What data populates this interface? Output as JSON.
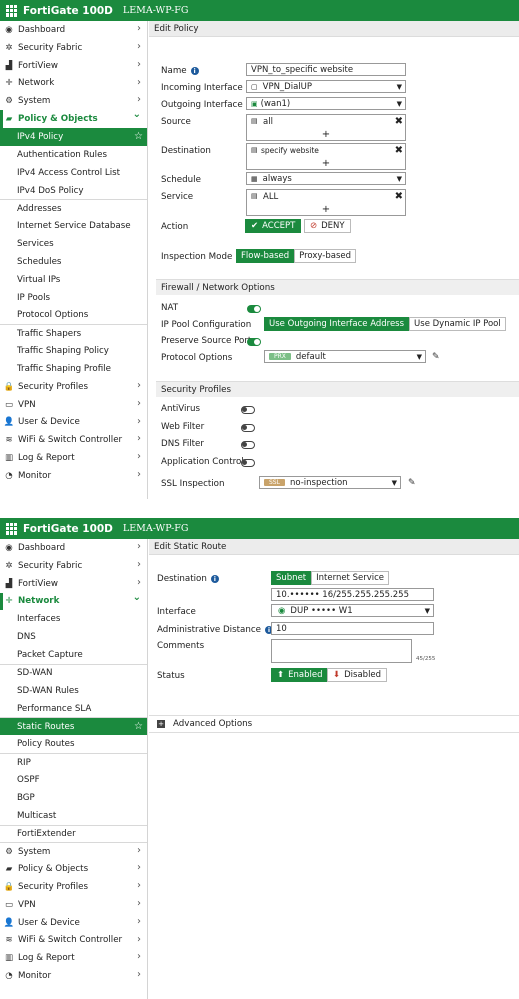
{
  "panel1": {
    "brand": "FortiGate 100D",
    "hostname": "LEMA-WP-FG",
    "nav": [
      {
        "label": "Dashboard",
        "icon": "dashboard-icon",
        "chevron": true
      },
      {
        "label": "Security Fabric",
        "icon": "fabric-icon",
        "chevron": true
      },
      {
        "label": "FortiView",
        "icon": "chart-icon",
        "chevron": true
      },
      {
        "label": "Network",
        "icon": "network-icon",
        "chevron": true
      },
      {
        "label": "System",
        "icon": "gear-icon",
        "chevron": true
      },
      {
        "label": "Policy & Objects",
        "icon": "policy-icon",
        "chevron": true
      },
      {
        "label": "IPv4 Policy"
      },
      {
        "label": "Authentication Rules"
      },
      {
        "label": "IPv4 Access Control List"
      },
      {
        "label": "IPv4 DoS Policy"
      },
      {
        "label": "Addresses"
      },
      {
        "label": "Internet Service Database"
      },
      {
        "label": "Services"
      },
      {
        "label": "Schedules"
      },
      {
        "label": "Virtual IPs"
      },
      {
        "label": "IP Pools"
      },
      {
        "label": "Protocol Options"
      },
      {
        "label": "Traffic Shapers"
      },
      {
        "label": "Traffic Shaping Policy"
      },
      {
        "label": "Traffic Shaping Profile"
      },
      {
        "label": "Security Profiles",
        "icon": "lock-icon",
        "chevron": true
      },
      {
        "label": "VPN",
        "icon": "vpn-icon",
        "chevron": true
      },
      {
        "label": "User & Device",
        "icon": "user-icon",
        "chevron": true
      },
      {
        "label": "WiFi & Switch Controller",
        "icon": "wifi-icon",
        "chevron": true
      },
      {
        "label": "Log & Report",
        "icon": "log-icon",
        "chevron": true
      },
      {
        "label": "Monitor",
        "icon": "monitor-icon",
        "chevron": true
      }
    ],
    "header": "Edit Policy",
    "form": {
      "name_label": "Name",
      "name_value": "VPN_to_specific website",
      "incoming_label": "Incoming Interface",
      "incoming_value": "VPN_DialUP",
      "outgoing_label": "Outgoing Interface",
      "outgoing_value": "(wan1)",
      "source_label": "Source",
      "source_value": "all",
      "destination_label": "Destination",
      "destination_value": "specify website",
      "schedule_label": "Schedule",
      "schedule_value": "always",
      "service_label": "Service",
      "service_value": "ALL",
      "action_label": "Action",
      "accept": "ACCEPT",
      "deny": "DENY",
      "inspection_label": "Inspection Mode",
      "flow_based": "Flow-based",
      "proxy_based": "Proxy-based"
    },
    "firewall_section": "Firewall / Network Options",
    "nat_label": "NAT",
    "ippool_label": "IP Pool Configuration",
    "use_outgoing": "Use Outgoing Interface Address",
    "use_dynamic": "Use Dynamic IP Pool",
    "preserve_label": "Preserve Source Port",
    "protocol_label": "Protocol Options",
    "protocol_badge": "PRX",
    "protocol_value": "default",
    "security_section": "Security Profiles",
    "antivirus": "AntiVirus",
    "webfilter": "Web Filter",
    "dnsfilter": "DNS Filter",
    "appcontrol": "Application Control",
    "ssl_label": "SSL Inspection",
    "ssl_badge": "SSL",
    "ssl_value": "no-inspection",
    "plus": "+"
  },
  "panel2": {
    "brand": "FortiGate 100D",
    "hostname": "LEMA-WP-FG",
    "nav": [
      {
        "label": "Dashboard",
        "icon": "dashboard-icon",
        "chevron": true
      },
      {
        "label": "Security Fabric",
        "icon": "fabric-icon",
        "chevron": true
      },
      {
        "label": "FortiView",
        "icon": "chart-icon",
        "chevron": true
      },
      {
        "label": "Network",
        "icon": "network-icon",
        "chevron": true
      },
      {
        "label": "Interfaces"
      },
      {
        "label": "DNS"
      },
      {
        "label": "Packet Capture"
      },
      {
        "label": "SD-WAN"
      },
      {
        "label": "SD-WAN Rules"
      },
      {
        "label": "Performance SLA"
      },
      {
        "label": "Static Routes"
      },
      {
        "label": "Policy Routes"
      },
      {
        "label": "RIP"
      },
      {
        "label": "OSPF"
      },
      {
        "label": "BGP"
      },
      {
        "label": "Multicast"
      },
      {
        "label": "FortiExtender"
      },
      {
        "label": "System",
        "icon": "gear-icon",
        "chevron": true
      },
      {
        "label": "Policy & Objects",
        "icon": "policy-icon",
        "chevron": true
      },
      {
        "label": "Security Profiles",
        "icon": "lock-icon",
        "chevron": true
      },
      {
        "label": "VPN",
        "icon": "vpn-icon",
        "chevron": true
      },
      {
        "label": "User & Device",
        "icon": "user-icon",
        "chevron": true
      },
      {
        "label": "WiFi & Switch Controller",
        "icon": "wifi-icon",
        "chevron": true
      },
      {
        "label": "Log & Report",
        "icon": "log-icon",
        "chevron": true
      },
      {
        "label": "Monitor",
        "icon": "monitor-icon",
        "chevron": true
      }
    ],
    "header": "Edit Static Route",
    "destination_label": "Destination",
    "subnet": "Subnet",
    "internet_service": "Internet Service",
    "destination_value": "10.•••••• 16/255.255.255.255",
    "interface_label": "Interface",
    "interface_value": "DUP ••••• W1",
    "admin_distance_label": "Administrative Distance",
    "admin_distance_value": "10",
    "comments_label": "Comments",
    "comments_count": "45/255",
    "status_label": "Status",
    "enabled": "Enabled",
    "disabled": "Disabled",
    "advanced": "Advanced Options"
  },
  "colors": {
    "accent": "#1b8a3e",
    "info": "#1d5a9c",
    "deny": "#c0392b"
  }
}
